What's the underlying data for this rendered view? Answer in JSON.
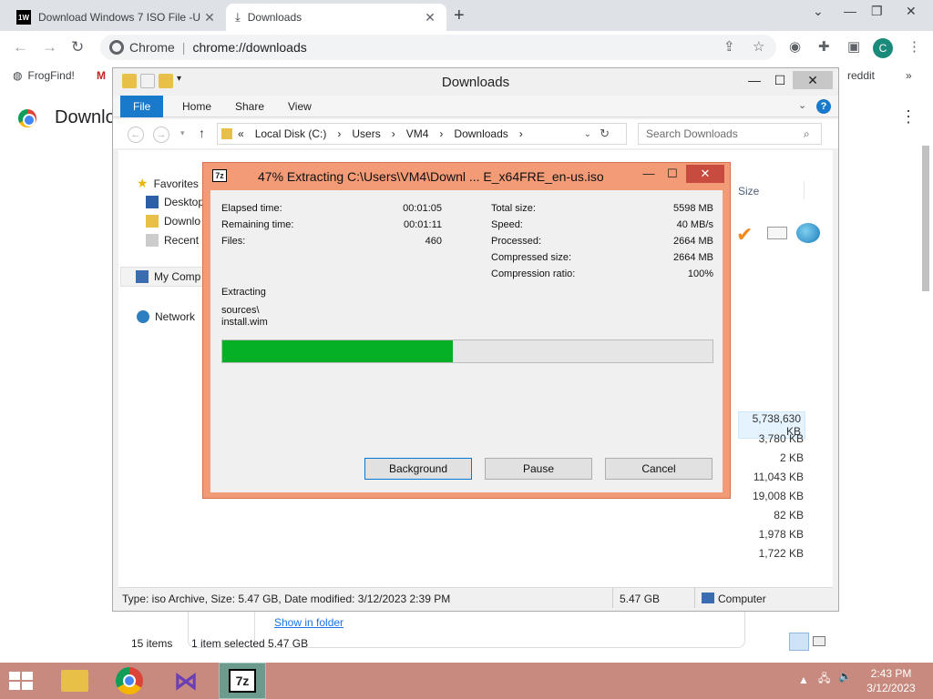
{
  "chrome": {
    "tabs": [
      {
        "title": "Download Windows 7 ISO File -U",
        "favicon": "1W"
      },
      {
        "title": "Downloads"
      }
    ],
    "omnibox_label": "Chrome",
    "url": "chrome://downloads",
    "avatar_letter": "C",
    "bookmarks": [
      "FrogFind!",
      "M",
      "reddit"
    ],
    "page_title": "Downlo",
    "show_in_folder": "Show in folder"
  },
  "explorer": {
    "title": "Downloads",
    "ribbon_tabs": [
      "File",
      "Home",
      "Share",
      "View"
    ],
    "address": [
      "«",
      "Local Disk (C:)",
      "›",
      "Users",
      "›",
      "VM4",
      "›",
      "Downloads",
      "›"
    ],
    "search_placeholder": "Search Downloads",
    "nav": {
      "favorites": "Favorites",
      "desktop": "Desktop",
      "downloads": "Downlo",
      "recent": "Recent p",
      "computer": "My Comp",
      "network": "Network"
    },
    "size_header": "Size",
    "sizes": [
      "5,738,630 KB",
      "3,780 KB",
      "2 KB",
      "11,043 KB",
      "19,008 KB",
      "82 KB",
      "1,978 KB",
      "1,722 KB"
    ],
    "items_count": "15 items",
    "selected": "1 item selected  5.47 GB",
    "details": "Type: iso Archive, Size: 5.47 GB, Date modified: 3/12/2023 2:39 PM",
    "details_size": "5.47 GB",
    "details_location": "Computer"
  },
  "zip": {
    "title": "47% Extracting C:\\Users\\VM4\\Downl ... E_x64FRE_en-us.iso",
    "left_stats": [
      {
        "label": "Elapsed time:",
        "value": "00:01:05"
      },
      {
        "label": "Remaining time:",
        "value": "00:01:11"
      },
      {
        "label": "Files:",
        "value": "460"
      }
    ],
    "right_stats": [
      {
        "label": "Total size:",
        "value": "5598 MB"
      },
      {
        "label": "Speed:",
        "value": "40 MB/s"
      },
      {
        "label": "Processed:",
        "value": "2664 MB"
      },
      {
        "label": "Compressed size:",
        "value": "2664 MB"
      },
      {
        "label": "Compression ratio:",
        "value": "100%"
      }
    ],
    "action": "Extracting",
    "path_line1": "sources\\",
    "path_line2": "install.wim",
    "progress_fraction": 0.47,
    "buttons": {
      "background": "Background",
      "pause": "Pause",
      "cancel": "Cancel"
    }
  },
  "taskbar": {
    "time": "2:43 PM",
    "date": "3/12/2023"
  }
}
